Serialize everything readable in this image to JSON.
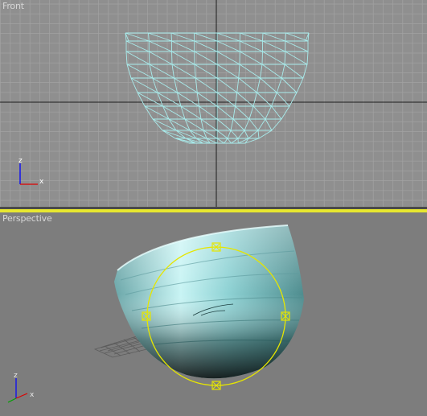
{
  "viewports": {
    "front": {
      "label": "Front",
      "axis_z": "z",
      "axis_x": "x"
    },
    "perspective": {
      "label": "Perspective",
      "axis_z": "z",
      "axis_x": "x"
    }
  },
  "colors": {
    "wireframe": "#a8ecec",
    "active_border": "#e8e830",
    "gizmo": "#ffff00",
    "grid_line": "#a8a8a8",
    "grid_major": "#202020"
  },
  "icons": {
    "front_axis_tripod": "axis-tripod-icon",
    "perspective_axis_tripod": "axis-tripod-icon",
    "gizmo_handle": "transform-handle-icon"
  }
}
